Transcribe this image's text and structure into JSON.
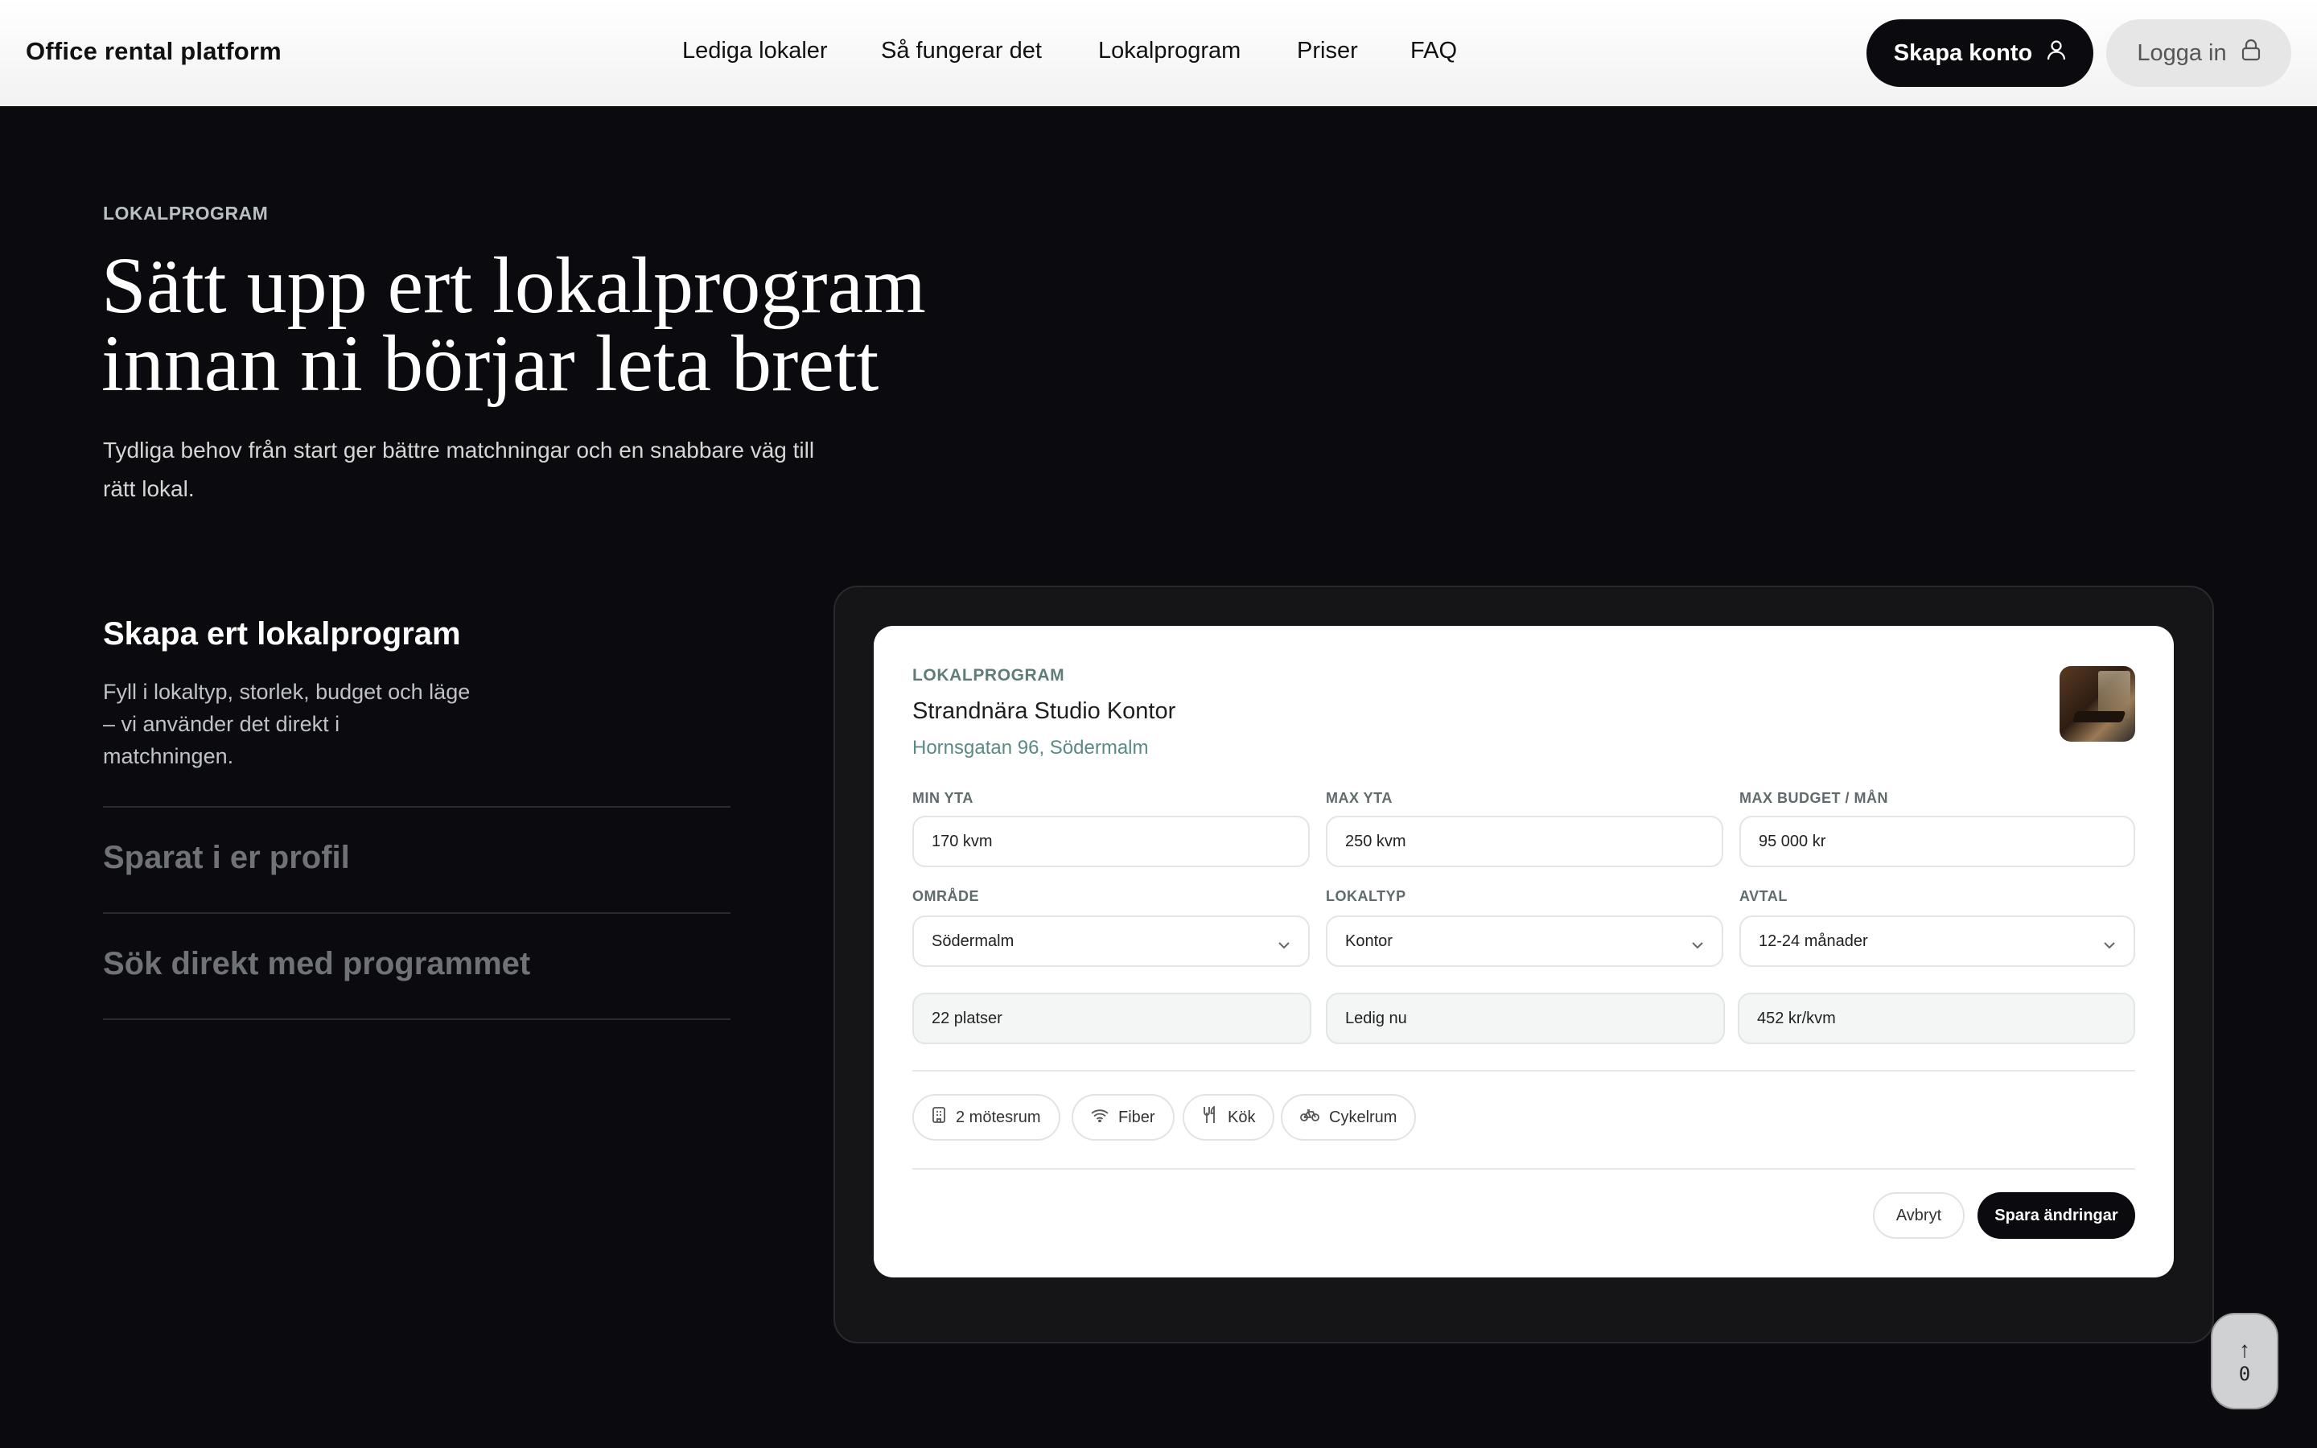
{
  "header": {
    "brand": "Office rental platform",
    "nav": [
      {
        "label": "Lediga lokaler"
      },
      {
        "label": "Så fungerar det"
      },
      {
        "label": "Lokalprogram"
      },
      {
        "label": "Priser"
      },
      {
        "label": "FAQ"
      }
    ],
    "create_account_label": "Skapa konto",
    "login_label": "Logga in"
  },
  "hero": {
    "eyebrow": "LOKALPROGRAM",
    "title_line1": "Sätt upp ert lokalprogram",
    "title_line2": "innan ni börjar leta brett",
    "subtitle_line1": "Tydliga behov från start ger bättre matchningar och en snabbare väg till",
    "subtitle_line2": "rätt lokal."
  },
  "steps": {
    "active": {
      "title": "Skapa ert lokalprogram",
      "desc_line1": "Fyll i lokaltyp, storlek, budget och läge",
      "desc_line2": "– vi använder det direkt i",
      "desc_line3": "matchningen."
    },
    "items": [
      {
        "title": "Sparat i er profil"
      },
      {
        "title": "Sök direkt med programmet"
      }
    ]
  },
  "card": {
    "eyebrow": "LOKALPROGRAM",
    "title": "Strandnära Studio Kontor",
    "address": "Hornsgatan 96, Södermalm",
    "fields": {
      "min_area": {
        "label": "MIN YTA",
        "value": "170 kvm"
      },
      "max_area": {
        "label": "MAX YTA",
        "value": "250 kvm"
      },
      "max_budget": {
        "label": "MAX BUDGET / MÅN",
        "value": "95 000 kr"
      },
      "area": {
        "label": "OMRÅDE",
        "value": "Södermalm"
      },
      "type": {
        "label": "LOKALTYP",
        "value": "Kontor"
      },
      "contract": {
        "label": "AVTAL",
        "value": "12-24 månader"
      },
      "seats": {
        "value": "22 platser"
      },
      "availability": {
        "value": "Ledig nu"
      },
      "price_per_sqm": {
        "value": "452 kr/kvm"
      }
    },
    "amenities": [
      {
        "label": "2 mötesrum",
        "icon": "building-icon"
      },
      {
        "label": "Fiber",
        "icon": "wifi-icon"
      },
      {
        "label": "Kök",
        "icon": "utensils-icon"
      },
      {
        "label": "Cykelrum",
        "icon": "bicycle-icon"
      }
    ],
    "cancel_label": "Avbryt",
    "save_label": "Spara ändringar"
  },
  "scroll_top": {
    "arrow": "↑",
    "count": "0"
  },
  "colors": {
    "background": "#0b0b0f",
    "accent_teal": "#5a8a84",
    "button_dark": "#0b0b0f"
  }
}
